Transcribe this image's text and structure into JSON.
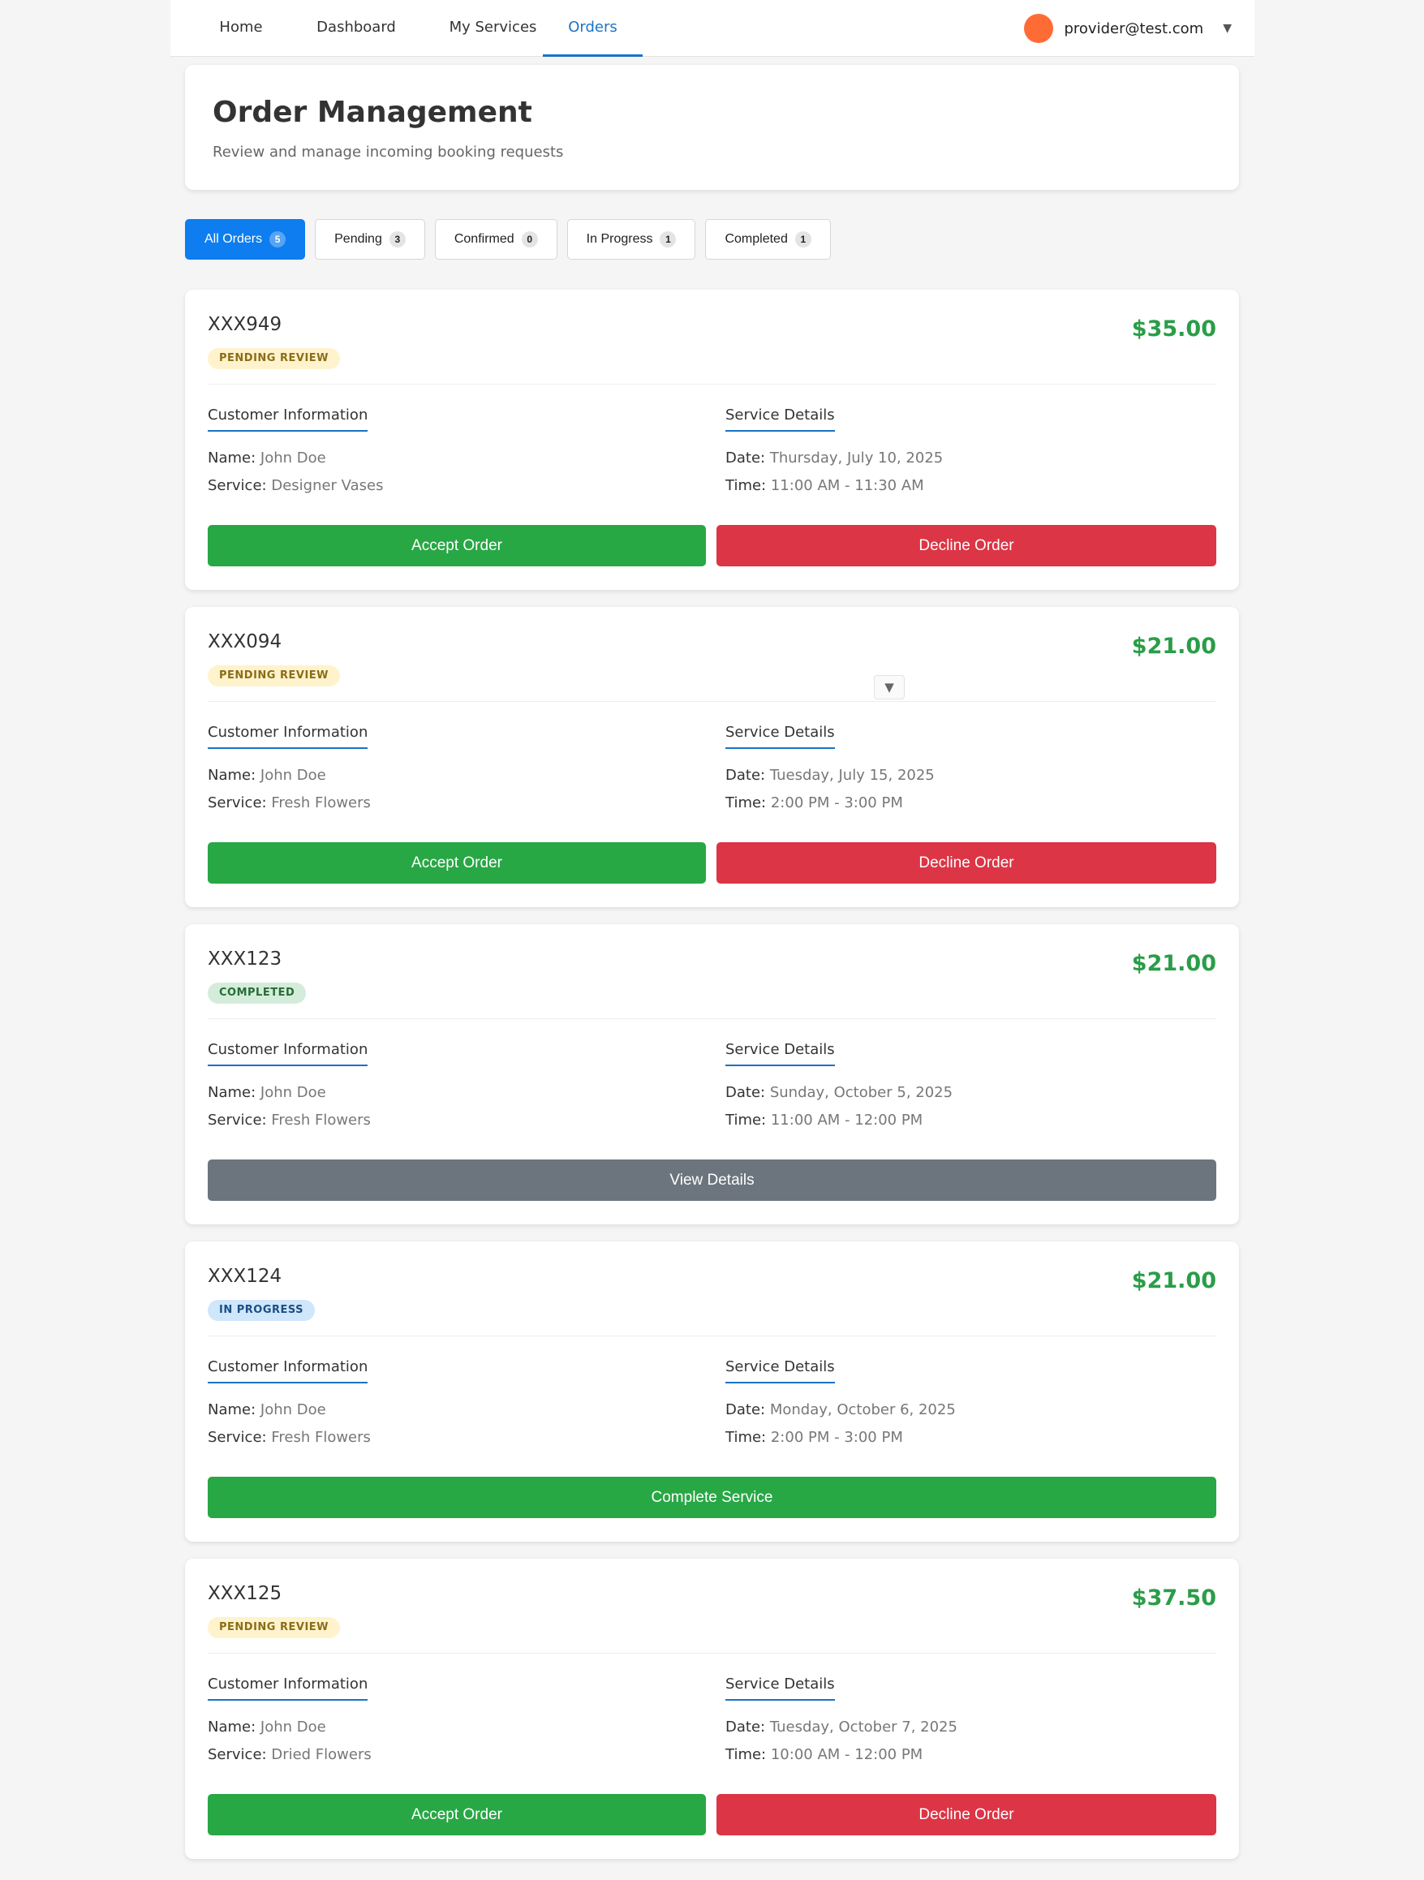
{
  "nav": {
    "items": [
      {
        "label": "Home"
      },
      {
        "label": "Dashboard"
      },
      {
        "label": "My Services"
      },
      {
        "label": "Orders"
      }
    ],
    "active": "Orders",
    "user_email": "provider@test.com",
    "dropdown_icon": "▼"
  },
  "header": {
    "title": "Order Management",
    "subtitle": "Review and manage incoming booking requests"
  },
  "tabs": [
    {
      "label": "All Orders",
      "count": "5",
      "active": true
    },
    {
      "label": "Pending",
      "count": "3"
    },
    {
      "label": "Confirmed",
      "count": "0"
    },
    {
      "label": "In Progress",
      "count": "1"
    },
    {
      "label": "Completed",
      "count": "1"
    }
  ],
  "labels": {
    "customer_info": "Customer Information",
    "service_details": "Service Details",
    "name": "Name:",
    "service": "Service:",
    "date": "Date:",
    "time": "Time:",
    "accept": "Accept Order",
    "decline": "Decline Order",
    "view_details": "View Details",
    "complete_service": "Complete Service"
  },
  "orders": [
    {
      "id": "XXX949",
      "price": "$35.00",
      "status": "PENDING REVIEW",
      "name": "John Doe",
      "service": "Designer Vases",
      "date": "Thursday, July 10, 2025",
      "time": "11:00 AM - 11:30 AM"
    },
    {
      "id": "XXX094",
      "price": "$21.00",
      "status": "PENDING REVIEW",
      "name": "John Doe",
      "service": "Fresh Flowers",
      "date": "Tuesday, July 15, 2025",
      "time": "2:00 PM - 3:00 PM"
    },
    {
      "id": "XXX123",
      "price": "$21.00",
      "status": "COMPLETED",
      "name": "John Doe",
      "service": "Fresh Flowers",
      "date": "Sunday, October 5, 2025",
      "time": "11:00 AM - 12:00 PM"
    },
    {
      "id": "XXX124",
      "price": "$21.00",
      "status": "IN PROGRESS",
      "name": "John Doe",
      "service": "Fresh Flowers",
      "date": "Monday, October 6, 2025",
      "time": "2:00 PM - 3:00 PM"
    },
    {
      "id": "XXX125",
      "price": "$37.50",
      "status": "PENDING REVIEW",
      "name": "John Doe",
      "service": "Dried Flowers",
      "date": "Tuesday, October 7, 2025",
      "time": "10:00 AM - 12:00 PM"
    }
  ],
  "colors": {
    "accent": "#0d7df0",
    "price": "#2a9d48",
    "accept": "#28a745",
    "decline": "#dc3545",
    "view": "#6c757d",
    "avatar": "#ff6b35"
  },
  "scroll_marker_icon": "▼"
}
